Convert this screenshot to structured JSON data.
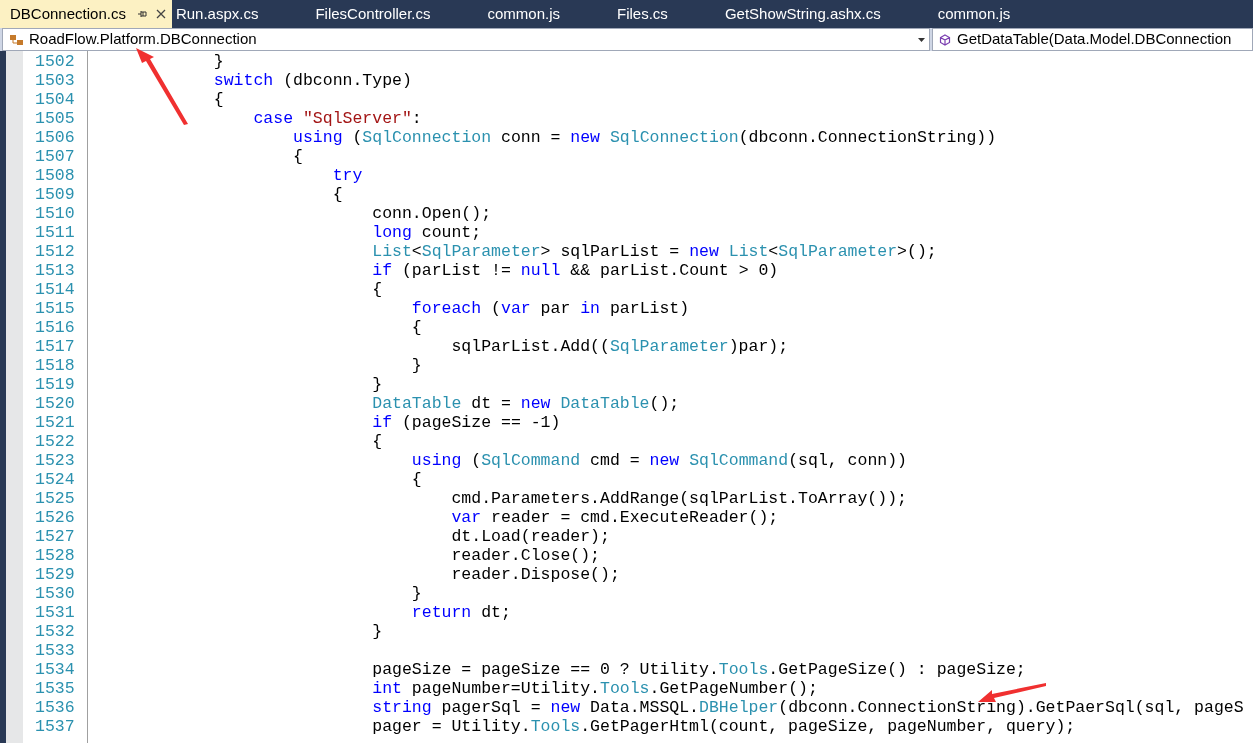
{
  "tabs": [
    {
      "label": "DBConnection.cs",
      "selected": true
    },
    {
      "label": "Run.aspx.cs",
      "selected": false
    },
    {
      "label": "FilesController.cs",
      "selected": false
    },
    {
      "label": "common.js",
      "selected": false
    },
    {
      "label": "Files.cs",
      "selected": false
    },
    {
      "label": "GetShowString.ashx.cs",
      "selected": false
    },
    {
      "label": "common.js",
      "selected": false
    }
  ],
  "navigation_bar": {
    "type_dropdown": "RoadFlow.Platform.DBConnection",
    "member_dropdown": "GetDataTable(Data.Model.DBConnection"
  },
  "editor": {
    "lines": [
      {
        "number": "1502",
        "tokens": [
          {
            "kind": "plain",
            "text": "            }"
          }
        ]
      },
      {
        "number": "1503",
        "tokens": [
          {
            "kind": "keyword",
            "text": "            switch"
          },
          {
            "kind": "plain",
            "text": " (dbconn.Type)"
          }
        ]
      },
      {
        "number": "1504",
        "tokens": [
          {
            "kind": "plain",
            "text": "            {"
          }
        ]
      },
      {
        "number": "1505",
        "tokens": [
          {
            "kind": "keyword",
            "text": "                case "
          },
          {
            "kind": "string",
            "text": "\"SqlServer\""
          },
          {
            "kind": "plain",
            "text": ":"
          }
        ]
      },
      {
        "number": "1506",
        "tokens": [
          {
            "kind": "keyword",
            "text": "                    using"
          },
          {
            "kind": "plain",
            "text": " ("
          },
          {
            "kind": "type",
            "text": "SqlConnection"
          },
          {
            "kind": "plain",
            "text": " conn = "
          },
          {
            "kind": "keyword",
            "text": "new "
          },
          {
            "kind": "type",
            "text": "SqlConnection"
          },
          {
            "kind": "plain",
            "text": "(dbconn.ConnectionString))"
          }
        ]
      },
      {
        "number": "1507",
        "tokens": [
          {
            "kind": "plain",
            "text": "                    {"
          }
        ]
      },
      {
        "number": "1508",
        "tokens": [
          {
            "kind": "keyword",
            "text": "                        try"
          }
        ]
      },
      {
        "number": "1509",
        "tokens": [
          {
            "kind": "plain",
            "text": "                        {"
          }
        ]
      },
      {
        "number": "1510",
        "tokens": [
          {
            "kind": "plain",
            "text": "                            conn.Open();"
          }
        ]
      },
      {
        "number": "1511",
        "tokens": [
          {
            "kind": "keyword",
            "text": "                            long"
          },
          {
            "kind": "plain",
            "text": " count;"
          }
        ]
      },
      {
        "number": "1512",
        "tokens": [
          {
            "kind": "type",
            "text": "                            List"
          },
          {
            "kind": "plain",
            "text": "<"
          },
          {
            "kind": "type",
            "text": "SqlParameter"
          },
          {
            "kind": "plain",
            "text": "> sqlParList = "
          },
          {
            "kind": "keyword",
            "text": "new "
          },
          {
            "kind": "type",
            "text": "List"
          },
          {
            "kind": "plain",
            "text": "<"
          },
          {
            "kind": "type",
            "text": "SqlParameter"
          },
          {
            "kind": "plain",
            "text": ">();"
          }
        ]
      },
      {
        "number": "1513",
        "tokens": [
          {
            "kind": "keyword",
            "text": "                            if"
          },
          {
            "kind": "plain",
            "text": " (parList != "
          },
          {
            "kind": "keyword",
            "text": "null"
          },
          {
            "kind": "plain",
            "text": " && parList.Count > 0)"
          }
        ]
      },
      {
        "number": "1514",
        "tokens": [
          {
            "kind": "plain",
            "text": "                            {"
          }
        ]
      },
      {
        "number": "1515",
        "tokens": [
          {
            "kind": "keyword",
            "text": "                                foreach"
          },
          {
            "kind": "plain",
            "text": " ("
          },
          {
            "kind": "keyword",
            "text": "var"
          },
          {
            "kind": "plain",
            "text": " par "
          },
          {
            "kind": "keyword",
            "text": "in"
          },
          {
            "kind": "plain",
            "text": " parList)"
          }
        ]
      },
      {
        "number": "1516",
        "tokens": [
          {
            "kind": "plain",
            "text": "                                {"
          }
        ]
      },
      {
        "number": "1517",
        "tokens": [
          {
            "kind": "plain",
            "text": "                                    sqlParList.Add(("
          },
          {
            "kind": "type",
            "text": "SqlParameter"
          },
          {
            "kind": "plain",
            "text": ")par);"
          }
        ]
      },
      {
        "number": "1518",
        "tokens": [
          {
            "kind": "plain",
            "text": "                                }"
          }
        ]
      },
      {
        "number": "1519",
        "tokens": [
          {
            "kind": "plain",
            "text": "                            }"
          }
        ]
      },
      {
        "number": "1520",
        "tokens": [
          {
            "kind": "type",
            "text": "                            DataTable"
          },
          {
            "kind": "plain",
            "text": " dt = "
          },
          {
            "kind": "keyword",
            "text": "new "
          },
          {
            "kind": "type",
            "text": "DataTable"
          },
          {
            "kind": "plain",
            "text": "();"
          }
        ]
      },
      {
        "number": "1521",
        "tokens": [
          {
            "kind": "keyword",
            "text": "                            if"
          },
          {
            "kind": "plain",
            "text": " (pageSize == -1)"
          }
        ]
      },
      {
        "number": "1522",
        "tokens": [
          {
            "kind": "plain",
            "text": "                            {"
          }
        ]
      },
      {
        "number": "1523",
        "tokens": [
          {
            "kind": "keyword",
            "text": "                                using"
          },
          {
            "kind": "plain",
            "text": " ("
          },
          {
            "kind": "type",
            "text": "SqlCommand"
          },
          {
            "kind": "plain",
            "text": " cmd = "
          },
          {
            "kind": "keyword",
            "text": "new "
          },
          {
            "kind": "type",
            "text": "SqlCommand"
          },
          {
            "kind": "plain",
            "text": "(sql, conn))"
          }
        ]
      },
      {
        "number": "1524",
        "tokens": [
          {
            "kind": "plain",
            "text": "                                {"
          }
        ]
      },
      {
        "number": "1525",
        "tokens": [
          {
            "kind": "plain",
            "text": "                                    cmd.Parameters.AddRange(sqlParList.ToArray());"
          }
        ]
      },
      {
        "number": "1526",
        "tokens": [
          {
            "kind": "keyword",
            "text": "                                    var"
          },
          {
            "kind": "plain",
            "text": " reader = cmd.ExecuteReader();"
          }
        ]
      },
      {
        "number": "1527",
        "tokens": [
          {
            "kind": "plain",
            "text": "                                    dt.Load(reader);"
          }
        ]
      },
      {
        "number": "1528",
        "tokens": [
          {
            "kind": "plain",
            "text": "                                    reader.Close();"
          }
        ]
      },
      {
        "number": "1529",
        "tokens": [
          {
            "kind": "plain",
            "text": "                                    reader.Dispose();"
          }
        ]
      },
      {
        "number": "1530",
        "tokens": [
          {
            "kind": "plain",
            "text": "                                }"
          }
        ]
      },
      {
        "number": "1531",
        "tokens": [
          {
            "kind": "keyword",
            "text": "                                return"
          },
          {
            "kind": "plain",
            "text": " dt;"
          }
        ]
      },
      {
        "number": "1532",
        "tokens": [
          {
            "kind": "plain",
            "text": "                            }"
          }
        ]
      },
      {
        "number": "1533"
      },
      {
        "number": "1534",
        "tokens": [
          {
            "kind": "plain",
            "text": "                            pageSize = pageSize == 0 ? Utility."
          },
          {
            "kind": "type",
            "text": "Tools"
          },
          {
            "kind": "plain",
            "text": ".GetPageSize() : pageSize;"
          }
        ]
      },
      {
        "number": "1535",
        "tokens": [
          {
            "kind": "keyword",
            "text": "                            int"
          },
          {
            "kind": "plain",
            "text": " pageNumber=Utility."
          },
          {
            "kind": "type",
            "text": "Tools"
          },
          {
            "kind": "plain",
            "text": ".GetPageNumber();"
          }
        ]
      },
      {
        "number": "1536",
        "tokens": [
          {
            "kind": "keyword",
            "text": "                            string"
          },
          {
            "kind": "plain",
            "text": " pagerSql = "
          },
          {
            "kind": "keyword",
            "text": "new"
          },
          {
            "kind": "plain",
            "text": " Data.MSSQL."
          },
          {
            "kind": "type",
            "text": "DBHelper"
          },
          {
            "kind": "plain",
            "text": "(dbconn.ConnectionString).GetPaerSql(sql, pageS"
          }
        ]
      },
      {
        "number": "1537",
        "tokens": [
          {
            "kind": "plain",
            "text": "                            pager = Utility."
          },
          {
            "kind": "type",
            "text": "Tools"
          },
          {
            "kind": "plain",
            "text": ".GetPagerHtml(count, pageSize, pageNumber, query);"
          }
        ]
      }
    ]
  }
}
